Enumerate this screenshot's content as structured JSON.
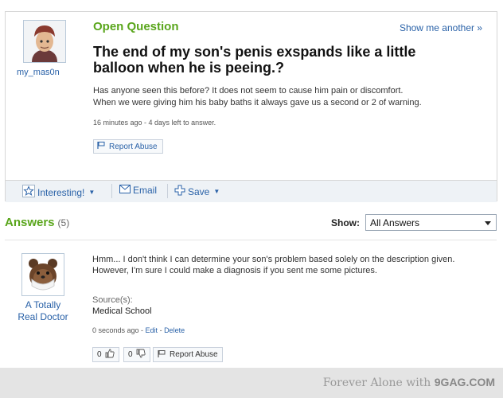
{
  "question": {
    "section_label": "Open Question",
    "show_another": "Show me another »",
    "username": "my_mas0n",
    "title": "The end of my son's penis exspands like a little balloon when he is peeing.?",
    "body_line1": "Has anyone seen this before? It does not seem to cause him pain or discomfort.",
    "body_line2": "When we were giving him his baby baths it always gave us a second or 2 of warning.",
    "meta": "16 minutes ago - 4 days left to answer.",
    "report_label": "Report Abuse"
  },
  "toolbar": {
    "interesting_label": "Interesting!",
    "email_label": "Email",
    "save_label": "Save"
  },
  "answers": {
    "heading": "Answers",
    "count": "(5)",
    "show_label": "Show:",
    "filter_value": "All Answers"
  },
  "answer": {
    "username_line1": "A Totally",
    "username_line2": "Real Doctor",
    "body": "Hmm... I don't think I can determine your son's problem based solely on the description given. However, I'm sure I could make a diagnosis if you sent me some pictures.",
    "source_label": "Source(s):",
    "source_value": "Medical School",
    "meta_time": "0 seconds ago - ",
    "meta_edit": "Edit",
    "meta_sep": " - ",
    "meta_delete": "Delete",
    "thumbs_up_count": "0",
    "thumbs_down_count": "0",
    "report_label": "Report Abuse"
  },
  "footer": {
    "text": "Forever Alone with ",
    "brand": "9GAG.COM"
  },
  "icons": {
    "interesting": "star-icon",
    "email": "envelope-icon",
    "save": "plus-icon",
    "report": "flag-icon"
  },
  "colors": {
    "accent_green": "#5aa61c",
    "link_blue": "#2a62a8"
  }
}
